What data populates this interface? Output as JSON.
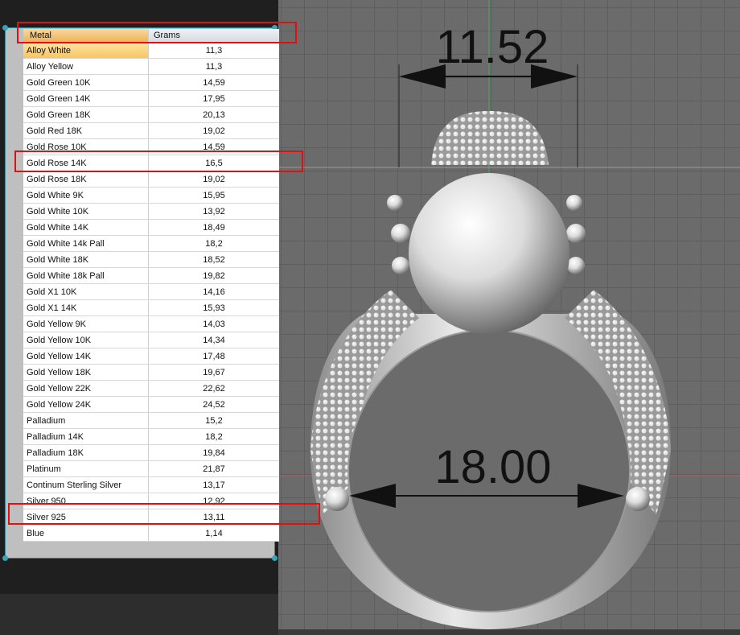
{
  "table": {
    "headers": {
      "metal": "Metal",
      "grams": "Grams"
    },
    "rows": [
      {
        "metal": "Alloy White",
        "grams": "11,3"
      },
      {
        "metal": "Alloy Yellow",
        "grams": "11,3"
      },
      {
        "metal": "Gold Green 10K",
        "grams": "14,59"
      },
      {
        "metal": "Gold Green 14K",
        "grams": "17,95"
      },
      {
        "metal": "Gold Green 18K",
        "grams": "20,13"
      },
      {
        "metal": "Gold Red 18K",
        "grams": "19,02"
      },
      {
        "metal": "Gold Rose 10K",
        "grams": "14,59"
      },
      {
        "metal": "Gold Rose 14K",
        "grams": "16,5"
      },
      {
        "metal": "Gold Rose 18K",
        "grams": "19,02"
      },
      {
        "metal": "Gold White 9K",
        "grams": "15,95"
      },
      {
        "metal": "Gold White 10K",
        "grams": "13,92"
      },
      {
        "metal": "Gold White 14K",
        "grams": "18,49"
      },
      {
        "metal": "Gold White 14k Pall",
        "grams": "18,2"
      },
      {
        "metal": "Gold White 18K",
        "grams": "18,52"
      },
      {
        "metal": "Gold White 18k Pall",
        "grams": "19,82"
      },
      {
        "metal": "Gold X1 10K",
        "grams": "14,16"
      },
      {
        "metal": "Gold X1 14K",
        "grams": "15,93"
      },
      {
        "metal": "Gold Yellow 9K",
        "grams": "14,03"
      },
      {
        "metal": "Gold Yellow 10K",
        "grams": "14,34"
      },
      {
        "metal": "Gold Yellow 14K",
        "grams": "17,48"
      },
      {
        "metal": "Gold Yellow 18K",
        "grams": "19,67"
      },
      {
        "metal": "Gold Yellow 22K",
        "grams": "22,62"
      },
      {
        "metal": "Gold Yellow 24K",
        "grams": "24,52"
      },
      {
        "metal": "Palladium",
        "grams": "15,2"
      },
      {
        "metal": "Palladium 14K",
        "grams": "18,2"
      },
      {
        "metal": "Palladium 18K",
        "grams": "19,84"
      },
      {
        "metal": "Platinum",
        "grams": "21,87"
      },
      {
        "metal": "Continum Sterling Silver",
        "grams": "13,17"
      },
      {
        "metal": "Silver 950",
        "grams": "12,92"
      },
      {
        "metal": "Silver 925",
        "grams": "13,11"
      },
      {
        "metal": "Blue",
        "grams": "1,14"
      }
    ],
    "selected_row": "Alloy White",
    "highlighted_rows": [
      "Gold Rose 14K",
      "Silver 925"
    ]
  },
  "viewport": {
    "top_dimension": "11.52",
    "inner_dimension": "18.00"
  },
  "colors": {
    "highlight": "#e01010",
    "viewport_bg": "#6b6b6b",
    "frame": "#2a8ea0"
  }
}
